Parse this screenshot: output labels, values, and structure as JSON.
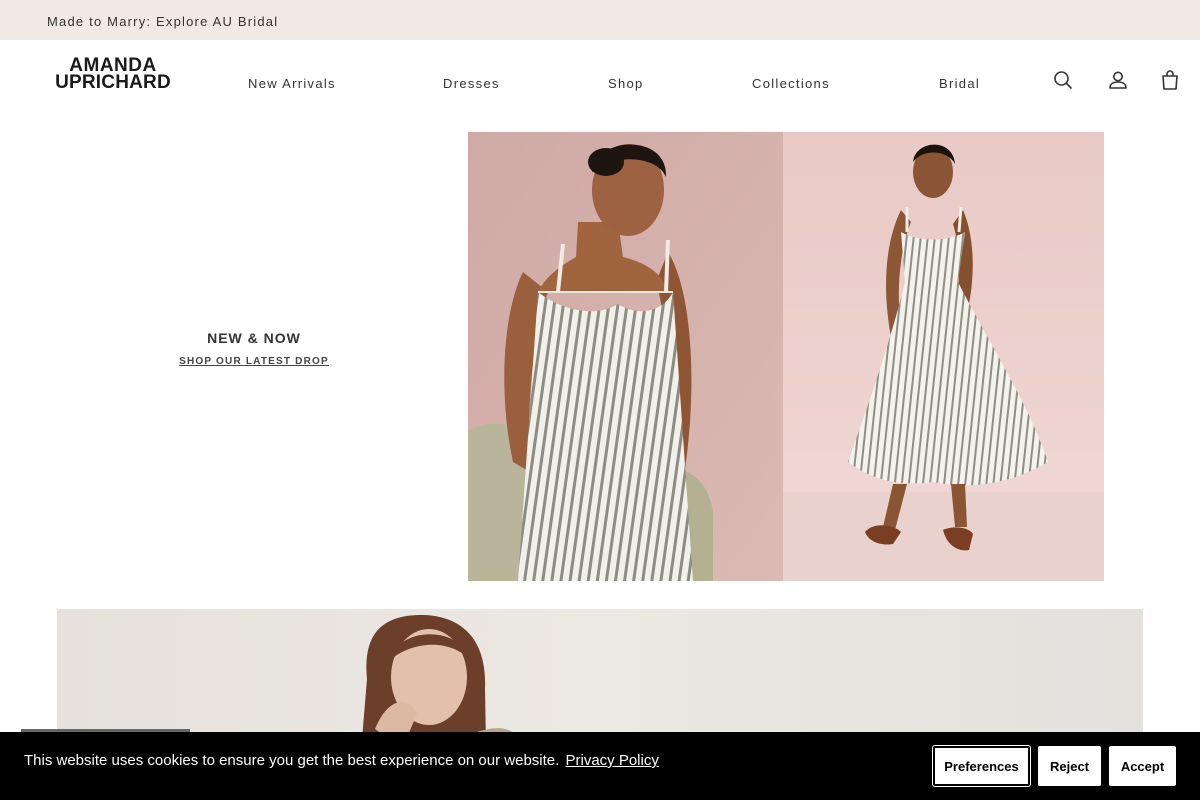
{
  "announcement": {
    "text": "Made to Marry: Explore AU Bridal"
  },
  "brand": {
    "line1": "AMANDA",
    "line2": "UPRICHARD"
  },
  "nav": [
    {
      "label": "New Arrivals"
    },
    {
      "label": "Dresses"
    },
    {
      "label": "Shop"
    },
    {
      "label": "Collections"
    },
    {
      "label": "Bridal"
    }
  ],
  "header_icons": [
    "search-icon",
    "account-icon",
    "cart-icon"
  ],
  "hero": {
    "title": "NEW & NOW",
    "cta": "SHOP OUR LATEST DROP"
  },
  "cookie": {
    "message": "This website uses cookies to ensure you get the best experience on our website.",
    "link": "Privacy Policy",
    "buttons": {
      "preferences": "Preferences",
      "reject": "Reject",
      "accept": "Accept"
    }
  },
  "colors": {
    "announcement_bg": "#f1e9e6",
    "cookie_bg": "#000000",
    "text": "#333333"
  }
}
